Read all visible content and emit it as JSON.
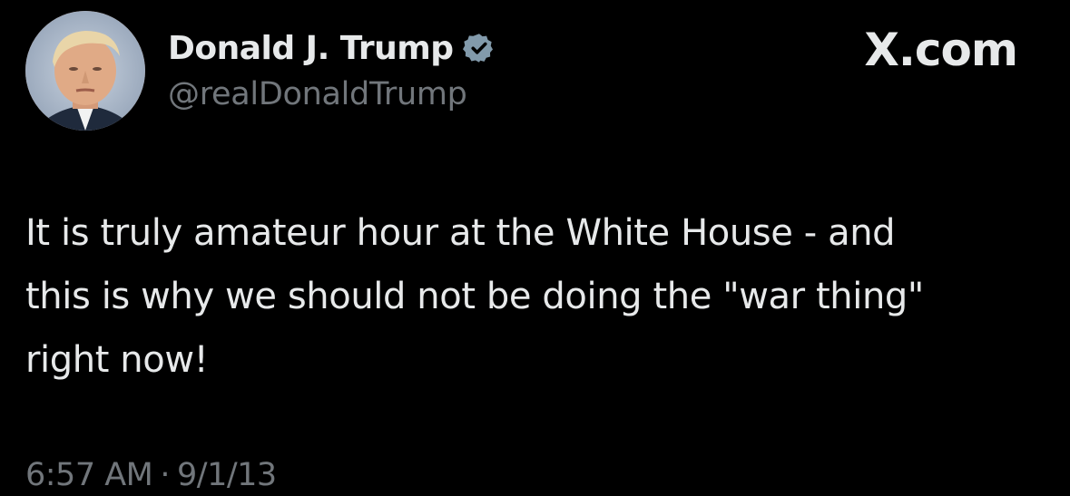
{
  "author": {
    "display_name": "Donald J. Trump",
    "handle": "@realDonaldTrump",
    "verified_icon": "verified-badge-icon",
    "avatar": "profile-photo"
  },
  "brand": {
    "logo_text": "X.com"
  },
  "tweet": {
    "text": "It is truly amateur hour at the White House - and\nthis is why we should not be doing the \"war thing\"\nright now!",
    "time": "6:57 AM",
    "separator": "·",
    "date": "9/1/13"
  },
  "colors": {
    "background": "#000000",
    "primary_text": "#e7e9ea",
    "secondary_text": "#71767b",
    "verified_badge": "#829aab"
  }
}
